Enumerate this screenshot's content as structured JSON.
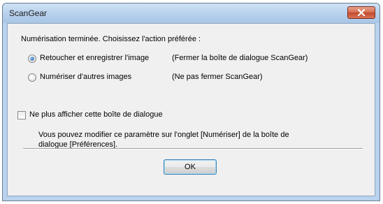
{
  "window": {
    "title": "ScanGear"
  },
  "dialog": {
    "prompt": "Numérisation terminée. Choisissez l'action préférée :",
    "options": [
      {
        "label": "Retoucher et enregistrer l'image",
        "note": "(Fermer la boîte de dialogue ScanGear)",
        "selected": true
      },
      {
        "label": "Numériser d'autres images",
        "note": "(Ne pas fermer ScanGear)",
        "selected": false
      }
    ],
    "dont_show_label": "Ne plus afficher cette boîte de dialogue",
    "dont_show_checked": false,
    "info_line1": "Vous pouvez modifier ce paramètre sur l'onglet [Numériser] de la boîte de",
    "info_line2": "dialogue [Préférences].",
    "ok_label": "OK"
  },
  "icons": {
    "close": "close-x-icon",
    "radio": "radio-dot-icon"
  },
  "colors": {
    "title_bar": "#b6d0ec",
    "close_button": "#c2472b",
    "client_bg": "#f0f0f0",
    "ok_border": "#3c7fb1"
  }
}
